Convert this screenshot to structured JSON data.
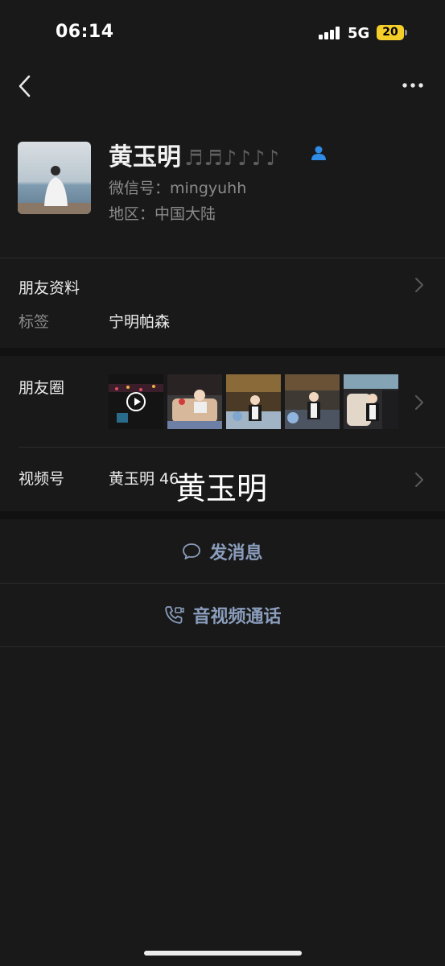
{
  "status_bar": {
    "time": "06:14",
    "network": "5G",
    "battery_level": "20"
  },
  "profile": {
    "name": "黄玉明",
    "name_notes": "♬♬♪♪♪♪",
    "wechat_id": "微信号：mingyuhh",
    "region": "地区：中国大陆"
  },
  "friend_info": {
    "title": "朋友资料",
    "tag_label": "标签",
    "tag_value": "宁明帕森"
  },
  "moments": {
    "title": "朋友圈"
  },
  "channels": {
    "title": "视频号",
    "value": "黄玉明 46"
  },
  "overlay_name": "黄玉明",
  "actions": {
    "message": "发消息",
    "call": "音视频通话"
  },
  "colors": {
    "background": "#191919",
    "accent_link": "#8a9dbc",
    "battery": "#f4cf2a",
    "contact_icon": "#2f8ce6"
  }
}
